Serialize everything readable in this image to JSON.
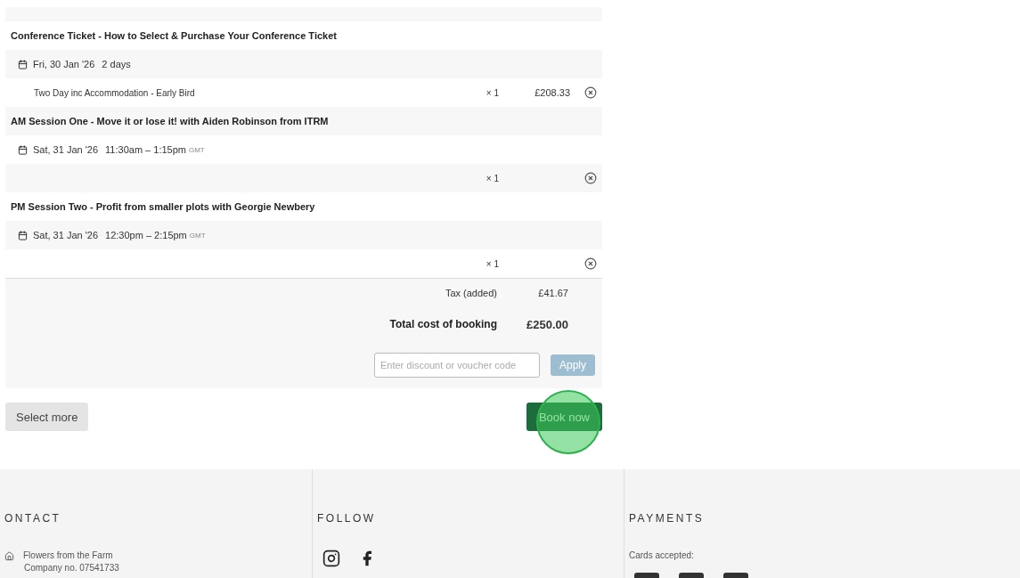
{
  "events": [
    {
      "title": "Conference Ticket - How to Select & Purchase Your Conference Ticket",
      "date": "Fri, 30 Jan '26",
      "time": "2 days",
      "item": {
        "name": "Two Day inc Accommodation - Early Bird",
        "qty": "× 1",
        "price": "£208.33"
      }
    },
    {
      "title": "AM Session One - Move it or lose it! with Aiden Robinson from ITRM",
      "date": "Sat, 31 Jan '26",
      "time": "11:30am – 1:15pm",
      "zone": "GMT",
      "item": {
        "qty": "× 1"
      }
    },
    {
      "title": "PM Session Two - Profit from smaller plots with Georgie Newbery",
      "date": "Sat, 31 Jan '26",
      "time": "12:30pm – 2:15pm",
      "zone": "GMT",
      "item": {
        "qty": "× 1"
      }
    }
  ],
  "tax": {
    "label": "Tax (added)",
    "value": "£41.67"
  },
  "total": {
    "label": "Total cost of booking",
    "value": "£250.00"
  },
  "discount": {
    "placeholder": "Enter discount or voucher code",
    "button": "Apply",
    "disabled": true
  },
  "select_more": "Select more",
  "book_now": "Book now",
  "click_highlight": true,
  "footer": {
    "contact": {
      "heading": "ONTACT",
      "lines": [
        "Flowers from the Farm",
        "Company no. 07541733"
      ]
    },
    "follow": {
      "heading": "FOLLOW"
    },
    "payments": {
      "heading": "PAYMENTS",
      "text": "Cards accepted:"
    }
  }
}
